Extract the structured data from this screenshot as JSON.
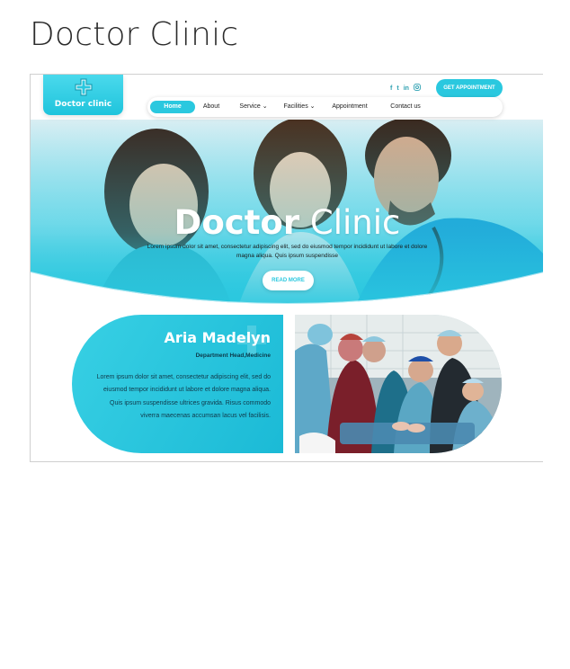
{
  "page": {
    "title": "Doctor Clinic"
  },
  "header": {
    "logo_text": "Doctor clinic",
    "social": [
      "f",
      "t",
      "in",
      "ig"
    ],
    "cta_label": "GET APPOINTMENT"
  },
  "nav": {
    "items": [
      {
        "label": "Home"
      },
      {
        "label": "About"
      },
      {
        "label": "Service ⌄"
      },
      {
        "label": "Facilities ⌄"
      },
      {
        "label": "Appointment"
      },
      {
        "label": "Contact us"
      }
    ]
  },
  "hero": {
    "title_bold": "Doctor",
    "title_light": "Clinic",
    "subtitle": "Lorem ipsum dolor sit amet, consectetur adipiscing elit, sed do eiusmod tempor incididunt ut labore et dolore magna aliqua. Quis ipsum suspendisse",
    "button_label": "READ MORE"
  },
  "profile": {
    "name": "Aria Madelyn",
    "role": "Department Head,Medicine",
    "bio": "Lorem ipsum dolor sit amet, consectetur adipiscing elit, sed do eiusmod tempor incididunt ut labore et dolore magna aliqua. Quis ipsum suspendisse ultrices gravida. Risus commodo viverra maecenas accumsan lacus vel facilisis."
  },
  "colors": {
    "accent": "#2ac8df",
    "accent_dark": "#1bbad6"
  }
}
